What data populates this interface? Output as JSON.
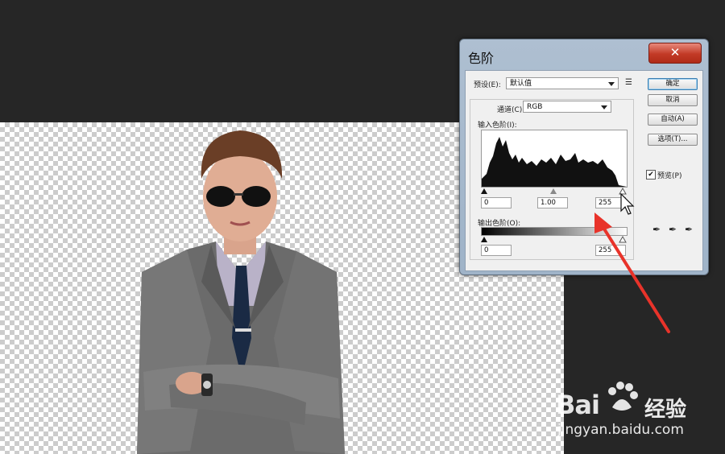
{
  "dialog": {
    "title": "色阶",
    "close_label": "✕",
    "preset_label": "预设(E):",
    "preset_value": "默认值",
    "channel_label": "通道(C):",
    "channel_value": "RGB",
    "input_levels_label": "输入色阶(I):",
    "input_black": "0",
    "input_gamma": "1.00",
    "input_white": "255",
    "output_levels_label": "输出色阶(O):",
    "output_black": "0",
    "output_white": "255",
    "buttons": {
      "ok": "确定",
      "cancel": "取消",
      "auto": "自动(A)",
      "options": "选项(T)..."
    },
    "preview_label": "预览(P)",
    "preview_checked": true
  },
  "watermark": {
    "brand": "Bai",
    "cn": "经验",
    "url": "jingyan.baidu.com"
  },
  "colors": {
    "workspace": "#262626",
    "arrow": "#e8332a"
  }
}
